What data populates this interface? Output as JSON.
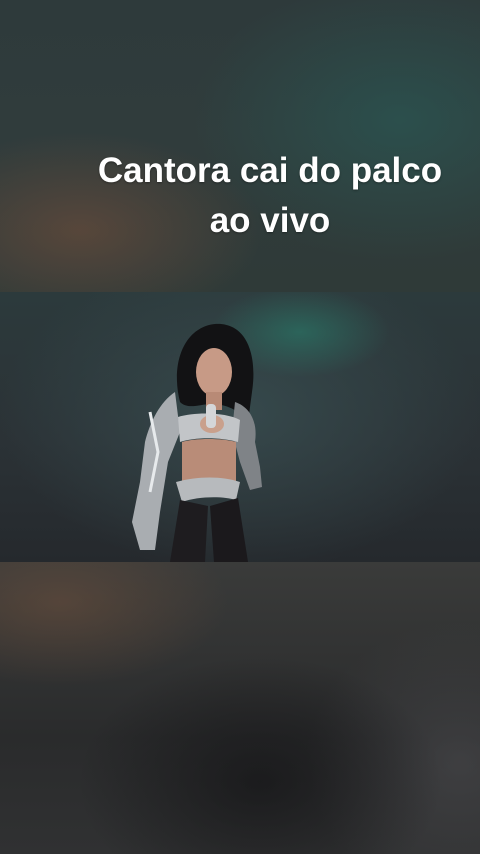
{
  "caption": {
    "line1": "Cantora cai do palco",
    "line2": "ao vivo"
  },
  "video": {
    "subject": "singer-performing-on-stage"
  },
  "colors": {
    "caption_text": "#ffffff",
    "backdrop": "#2e3a3b"
  }
}
